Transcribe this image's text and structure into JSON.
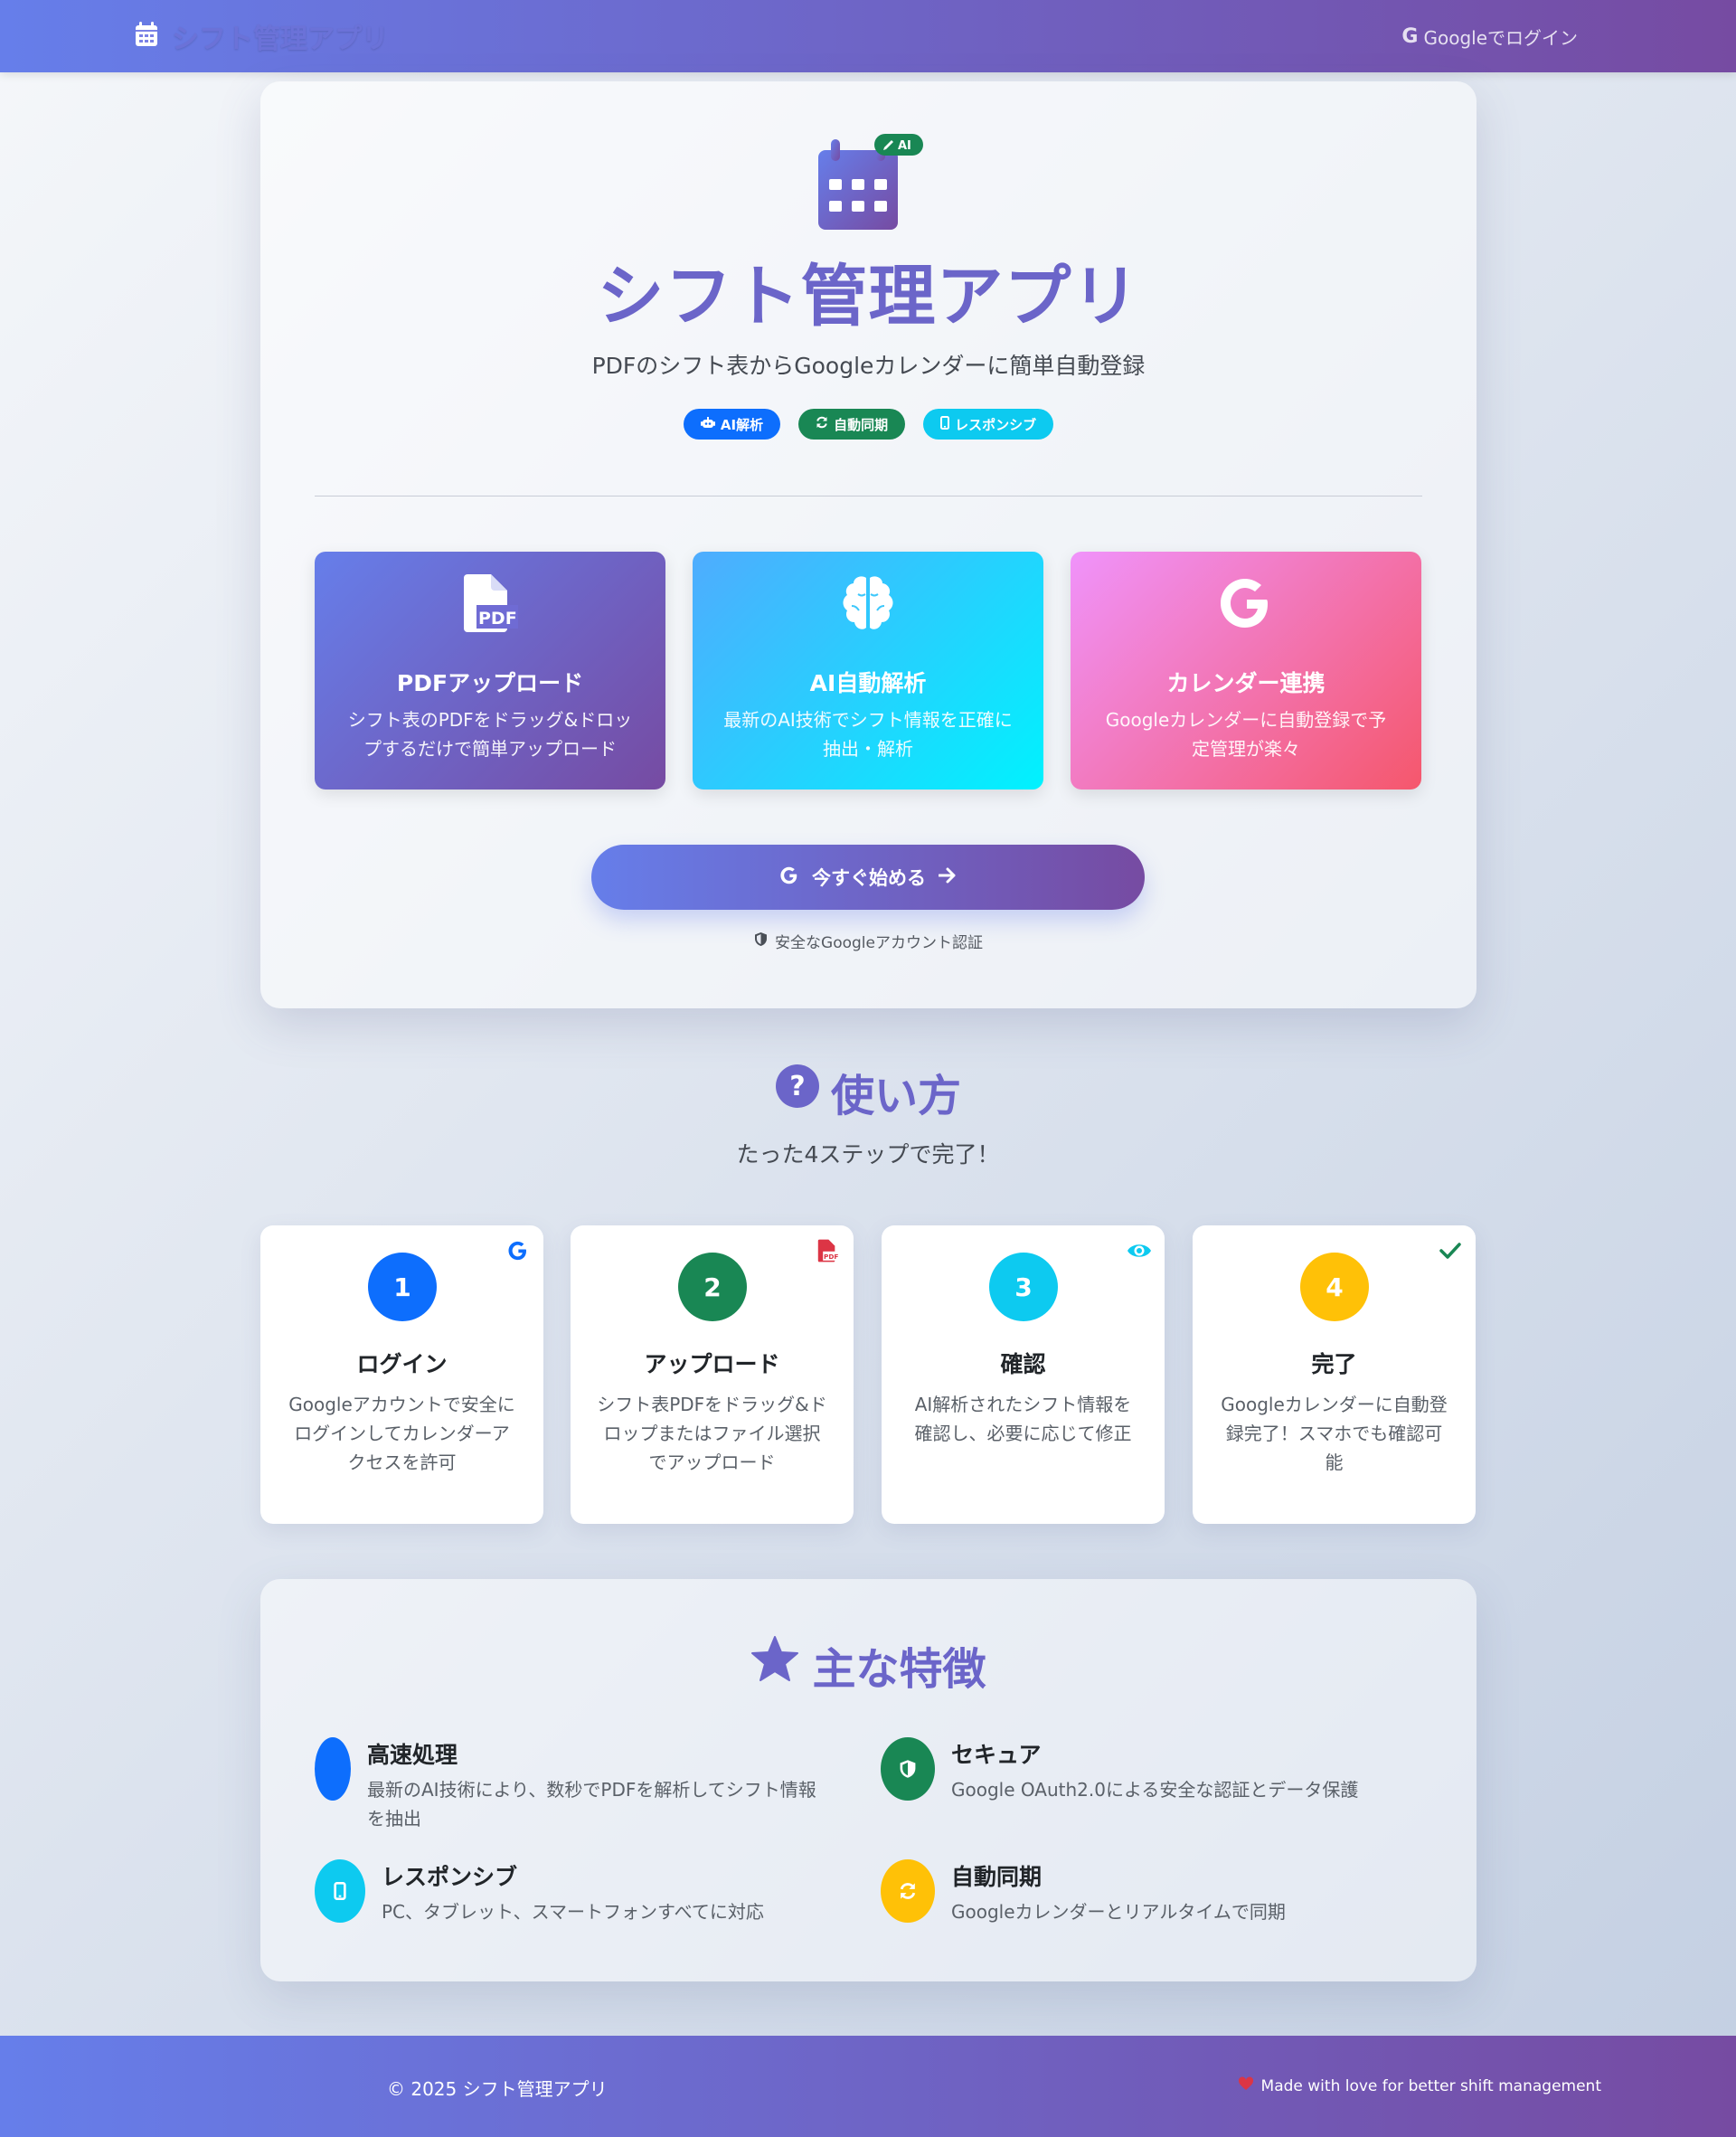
{
  "navbar": {
    "brand_icon": "calendar-icon",
    "brand_name": "シフト管理アプリ",
    "login_icon": "google-icon",
    "login_label": "Googleでログイン"
  },
  "hero": {
    "icon": "calendar-ai-icon",
    "ai_tag": "AI",
    "title": "シフト管理アプリ",
    "subtitle": "PDFのシフト表からGoogleカレンダーに簡単自動登録",
    "badges": [
      {
        "label": "AI解析",
        "icon": "robot-icon",
        "color": "#0d6efd"
      },
      {
        "label": "自動同期",
        "icon": "sync-icon",
        "color": "#198754"
      },
      {
        "label": "レスポンシブ",
        "icon": "mobile-icon",
        "color": "#0dcaf0"
      }
    ],
    "feature_cards": [
      {
        "icon": "pdf-file-icon",
        "title": "PDFアップロード",
        "desc": "シフト表のPDFをドラッグ&ドロップするだけで簡単アップロード"
      },
      {
        "icon": "brain-icon",
        "title": "AI自動解析",
        "desc": "最新のAI技術でシフト情報を正確に抽出・解析"
      },
      {
        "icon": "google-icon",
        "title": "カレンダー連携",
        "desc": "Googleカレンダーに自動登録で予定管理が楽々"
      }
    ],
    "cta_label": "今すぐ始める",
    "secure_text": "安全なGoogleアカウント認証"
  },
  "howto": {
    "title": "使い方",
    "subtitle": "たった4ステップで完了！",
    "steps": [
      {
        "num": "1",
        "title": "ログイン",
        "desc": "Googleアカウントで安全にログインしてカレンダーアクセスを許可",
        "icon": "google-icon",
        "color": "#0d6efd"
      },
      {
        "num": "2",
        "title": "アップロード",
        "desc": "シフト表PDFをドラッグ&ドロップまたはファイル選択でアップロード",
        "icon": "pdf-file-icon",
        "color": "#198754"
      },
      {
        "num": "3",
        "title": "確認",
        "desc": "AI解析されたシフト情報を確認し、必要に応じて修正",
        "icon": "eye-icon",
        "color": "#0dcaf0"
      },
      {
        "num": "4",
        "title": "完了",
        "desc": "Googleカレンダーに自動登録完了！スマホでも確認可能",
        "icon": "check-icon",
        "color": "#ffc107"
      }
    ]
  },
  "features": {
    "title": "主な特徴",
    "items": [
      {
        "title": "高速処理",
        "desc": "最新のAI技術により、数秒でPDFを解析してシフト情報を抽出",
        "icon": "bolt-icon",
        "color": "#0d6efd"
      },
      {
        "title": "セキュア",
        "desc": "Google OAuth2.0による安全な認証とデータ保護",
        "icon": "shield-icon",
        "color": "#198754"
      },
      {
        "title": "レスポンシブ",
        "desc": "PC、タブレット、スマートフォンすべてに対応",
        "icon": "mobile-icon",
        "color": "#0dcaf0"
      },
      {
        "title": "自動同期",
        "desc": "Googleカレンダーとリアルタイムで同期",
        "icon": "sync-icon",
        "color": "#ffc107"
      }
    ]
  },
  "footer": {
    "copyright": "© 2025 シフト管理アプリ",
    "made_with": "Made with love for better shift management"
  }
}
